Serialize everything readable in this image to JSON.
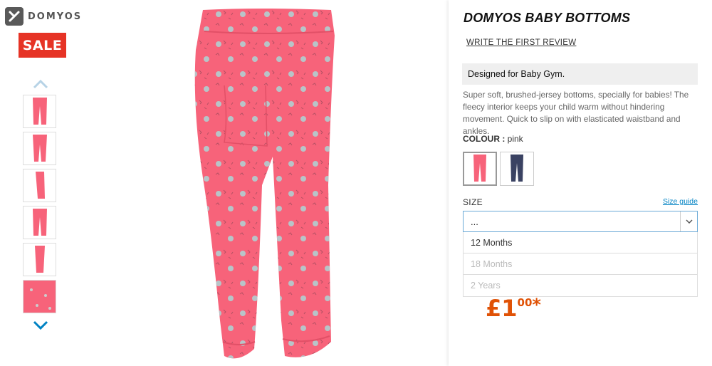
{
  "brand": {
    "name": "DOMYOS"
  },
  "badge": {
    "sale": "SALE"
  },
  "gallery": {
    "up_icon": "chevron-up-icon",
    "down_icon": "chevron-down-icon",
    "thumbnails": 6
  },
  "product": {
    "title": "DOMYOS BABY BOTTOMS",
    "review_link": "WRITE THE FIRST REVIEW",
    "designed_for": "Designed for Baby Gym.",
    "description": "Super soft, brushed-jersey bottoms, specially for babies! The fleecy interior keeps your child warm without hindering movement. Quick to slip on with elasticated waistband and ankles.",
    "colour_label": "COLOUR : ",
    "colour_value": "pink",
    "colours": [
      "pink",
      "navy"
    ],
    "size_label": "SIZE",
    "size_guide": "Size guide",
    "size_selected": "...",
    "size_options": [
      {
        "label": "12 Months",
        "available": true
      },
      {
        "label": "18 Months",
        "available": false
      },
      {
        "label": "2 Years",
        "available": false
      }
    ],
    "price_main": "£1",
    "price_decimal": "00",
    "price_star": "*",
    "accent_color": "#e05206",
    "sale_color": "#e63325",
    "link_color": "#0082c3"
  }
}
